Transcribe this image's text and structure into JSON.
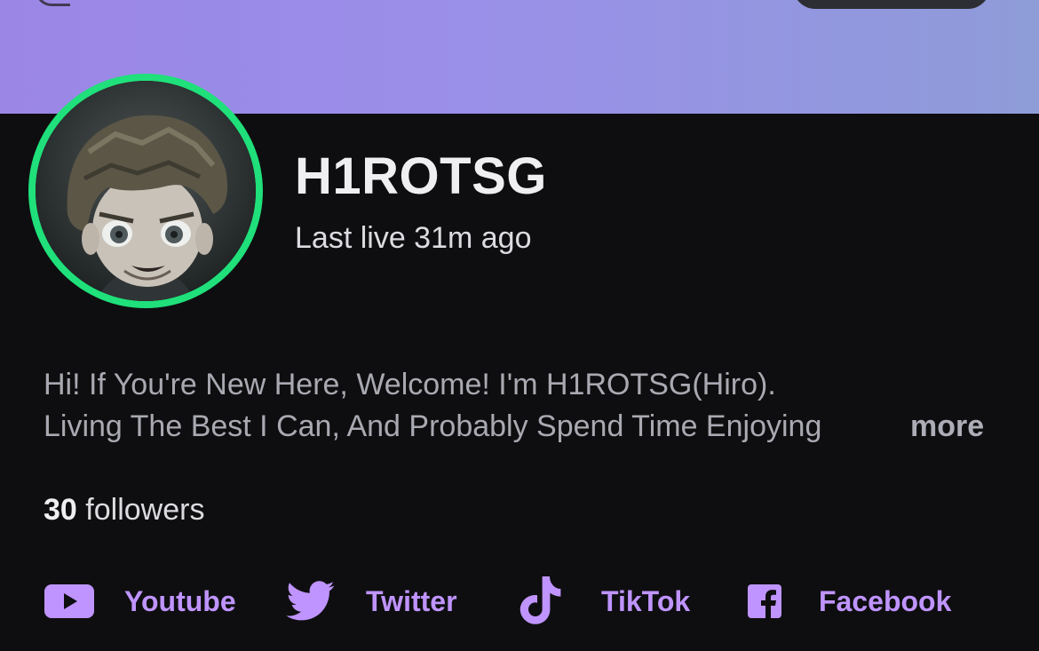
{
  "profile": {
    "username": "H1ROTSG",
    "last_live": "Last live 31m ago",
    "bio_line1": "Hi! If You're New Here, Welcome! I'm H1ROTSG(Hiro).",
    "bio_line2": "Living The Best I Can, And Probably Spend Time Enjoying",
    "more_label": "more",
    "followers_count": "30",
    "followers_label": "followers"
  },
  "socials": [
    {
      "icon": "youtube-icon",
      "label": "Youtube"
    },
    {
      "icon": "twitter-icon",
      "label": "Twitter"
    },
    {
      "icon": "tiktok-icon",
      "label": "TikTok"
    },
    {
      "icon": "facebook-icon",
      "label": "Facebook"
    }
  ],
  "colors": {
    "background": "#0e0e10",
    "accent": "#bf94ff",
    "live_ring": "#1fe07a",
    "banner_start": "#9b86e6",
    "banner_end": "#8e9cd8"
  }
}
